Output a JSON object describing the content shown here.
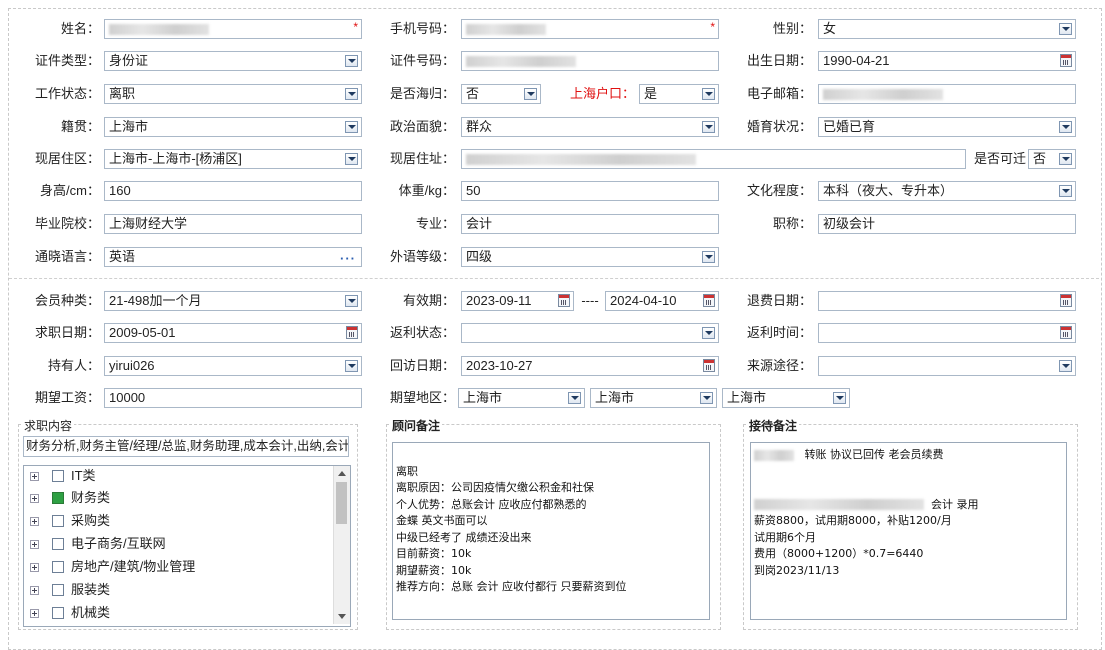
{
  "basic": {
    "name_label": "姓名：",
    "phone_label": "手机号码：",
    "gender_label": "性别：",
    "gender_value": "女",
    "id_type_label": "证件类型：",
    "id_type_value": "身份证",
    "id_no_label": "证件号码：",
    "birth_label": "出生日期：",
    "birth_value": "1990-04-21",
    "work_status_label": "工作状态：",
    "work_status_value": "离职",
    "overseas_label": "是否海归：",
    "overseas_value": "否",
    "hukou_label": "上海户口：",
    "hukou_value": "是",
    "email_label": "电子邮箱：",
    "native_label": "籍贯：",
    "native_value": "上海市",
    "political_label": "政治面貌：",
    "political_value": "群众",
    "marital_label": "婚育状况：",
    "marital_value": "已婚已育",
    "residence_label": "现居住区：",
    "residence_value": "上海市-上海市-[杨浦区]",
    "address_label": "现居住址：",
    "relocate_label": "是否可迁",
    "relocate_value": "否",
    "height_label": "身高/cm：",
    "height_value": "160",
    "weight_label": "体重/kg：",
    "weight_value": "50",
    "education_label": "文化程度：",
    "education_value": "本科（夜大、专升本）",
    "school_label": "毕业院校：",
    "school_value": "上海财经大学",
    "major_label": "专业：",
    "major_value": "会计",
    "title_label": "职称：",
    "title_value": "初级会计",
    "language_label": "通晓语言：",
    "language_value": "英语",
    "lang_level_label": "外语等级：",
    "lang_level_value": "四级"
  },
  "membership": {
    "type_label": "会员种类：",
    "type_value": "21-498加一个月",
    "validity_label": "有效期：",
    "valid_from": "2023-09-11",
    "range_sep": "----",
    "valid_to": "2024-04-10",
    "refund_date_label": "退费日期：",
    "job_date_label": "求职日期：",
    "job_date_value": "2009-05-01",
    "rebate_status_label": "返利状态：",
    "rebate_time_label": "返利时间：",
    "holder_label": "持有人：",
    "holder_value": "yirui026",
    "visit_label": "回访日期：",
    "visit_value": "2023-10-27",
    "source_label": "来源途径：",
    "salary_label": "期望工资：",
    "salary_value": "10000",
    "region_label": "期望地区：",
    "region_1": "上海市",
    "region_2": "上海市",
    "region_3": "上海市"
  },
  "job_content": {
    "title": "求职内容",
    "summary": "财务分析,财务主管/经理/总监,财务助理,成本会计,出纳,会计",
    "tree": [
      {
        "label": "IT类",
        "checked": false
      },
      {
        "label": "财务类",
        "checked": true
      },
      {
        "label": "采购类",
        "checked": false
      },
      {
        "label": "电子商务/互联网",
        "checked": false
      },
      {
        "label": "房地产/建筑/物业管理",
        "checked": false
      },
      {
        "label": "服装类",
        "checked": false
      },
      {
        "label": "机械类",
        "checked": false
      }
    ]
  },
  "advisor_notes": {
    "title": "顾问备注",
    "text": "\n离职\n离职原因：公司因疫情欠缴公积金和社保\n个人优势：总账会计 应收应付都熟悉的\n金蝶 英文书面可以\n中级已经考了 成绩还没出来\n目前薪资：10k\n期望薪资：10k\n推荐方向：总账 会计 应收付都行 只要薪资到位"
  },
  "reception_notes": {
    "title": "接待备注",
    "line1": "转账 协议已回传 老会员续费",
    "line2": "会计 录用",
    "rest": "薪资8800，试用期8000，补贴1200/月\n试用期6个月\n费用（8000+1200）*0.7=6440\n到岗2023/11/13"
  }
}
